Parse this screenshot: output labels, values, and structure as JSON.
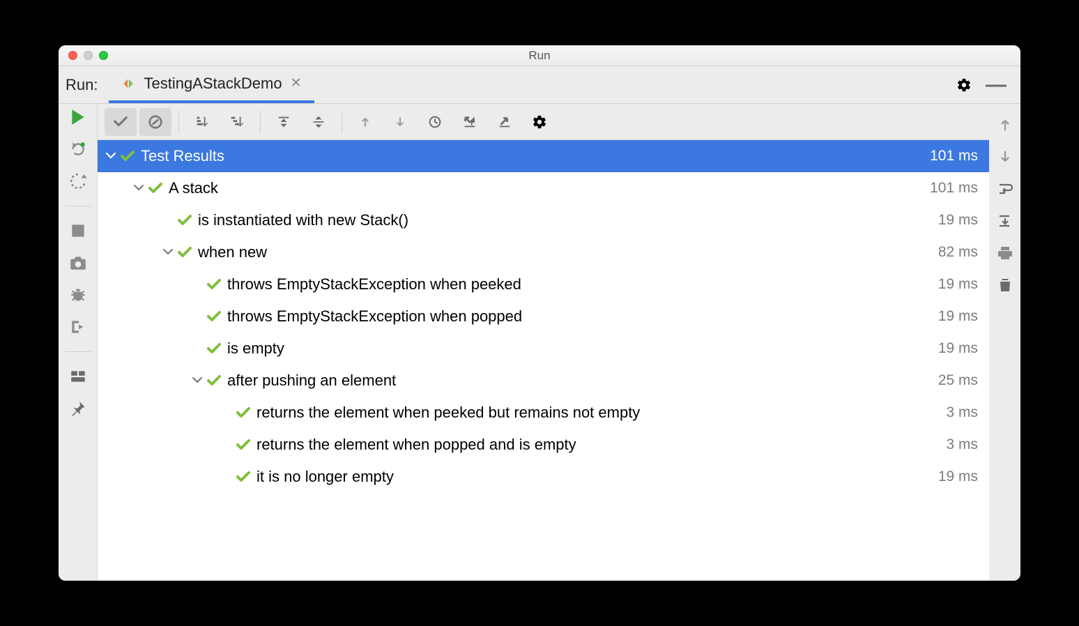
{
  "window": {
    "title": "Run"
  },
  "tabrow": {
    "label": "Run:",
    "tab_name": "TestingAStackDemo"
  },
  "tree": {
    "root": {
      "label": "Test Results",
      "time": "101 ms"
    },
    "n1": {
      "label": "A stack",
      "time": "101 ms"
    },
    "n1_1": {
      "label": "is instantiated with new Stack()",
      "time": "19 ms"
    },
    "n1_2": {
      "label": "when new",
      "time": "82 ms"
    },
    "n1_2_1": {
      "label": "throws EmptyStackException when peeked",
      "time": "19 ms"
    },
    "n1_2_2": {
      "label": "throws EmptyStackException when popped",
      "time": "19 ms"
    },
    "n1_2_3": {
      "label": "is empty",
      "time": "19 ms"
    },
    "n1_2_4": {
      "label": "after pushing an element",
      "time": "25 ms"
    },
    "n1_2_4_1": {
      "label": "returns the element when peeked but remains not empty",
      "time": "3 ms"
    },
    "n1_2_4_2": {
      "label": "returns the element when popped and is empty",
      "time": "3 ms"
    },
    "n1_2_4_3": {
      "label": "it is no longer empty",
      "time": "19 ms"
    }
  },
  "colors": {
    "accent": "#3b78e0",
    "pass": "#7fbf3f"
  }
}
